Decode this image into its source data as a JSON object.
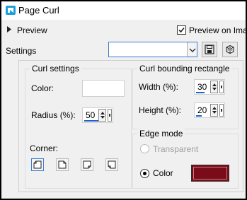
{
  "window": {
    "title": "Page Curl"
  },
  "preview": {
    "label": "Preview",
    "preview_on_image_label": "Preview on Imag",
    "preview_on_image_checked": true
  },
  "settings": {
    "label": "Settings",
    "preset_value": ""
  },
  "curl_settings": {
    "title": "Curl settings",
    "color_label": "Color:",
    "color_value": "#ffffff",
    "radius_label": "Radius (%):",
    "radius_value": "50",
    "corner_label": "Corner:",
    "corners": [
      "top-left",
      "top-right",
      "bottom-right",
      "bottom-left"
    ],
    "selected_corner": "top-left"
  },
  "bounding": {
    "title": "Curl bounding rectangle",
    "width_label": "Width (%):",
    "width_value": "30",
    "height_label": "Height (%):",
    "height_value": "20"
  },
  "edge_mode": {
    "title": "Edge mode",
    "transparent_label": "Transparent",
    "color_label": "Color",
    "selected": "Color",
    "color_value": "#7a0c1a"
  }
}
